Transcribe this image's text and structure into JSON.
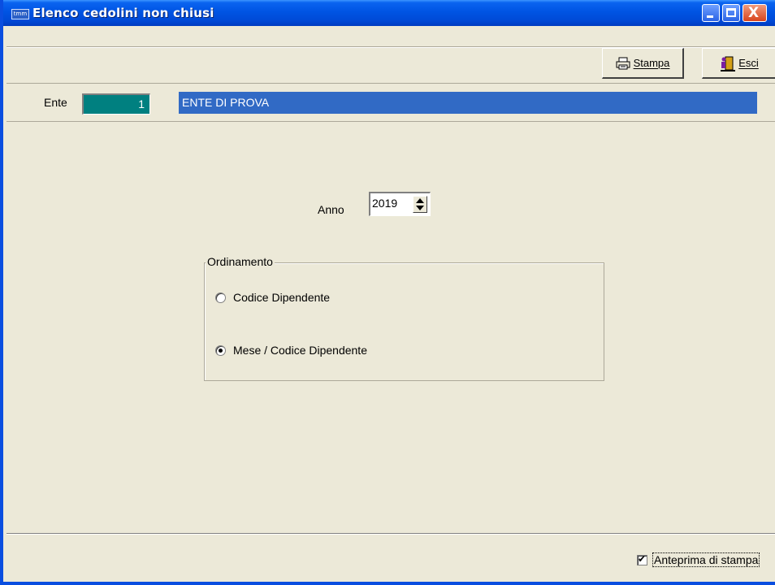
{
  "window": {
    "title": "Elenco cedolini non chiusi",
    "app_icon_text": "tmm",
    "close_glyph": "X"
  },
  "toolbar": {
    "stampa_label": "Stampa",
    "esci_label": "Esci"
  },
  "ente": {
    "label": "Ente",
    "code": "1",
    "name": "ENTE DI PROVA"
  },
  "anno": {
    "label": "Anno",
    "value": "2019"
  },
  "ordinamento": {
    "legend": "Ordinamento",
    "options": [
      {
        "label": "Codice Dipendente",
        "selected": false
      },
      {
        "label": "Mese / Codice Dipendente",
        "selected": true
      }
    ]
  },
  "footer": {
    "anteprima_label": "Anteprima di stampa",
    "anteprima_checked": true
  },
  "colors": {
    "titlebar": "#0054e3",
    "ente_code_bg": "#008080",
    "ente_name_bg": "#316ac5",
    "form_bg": "#ece9d8"
  }
}
